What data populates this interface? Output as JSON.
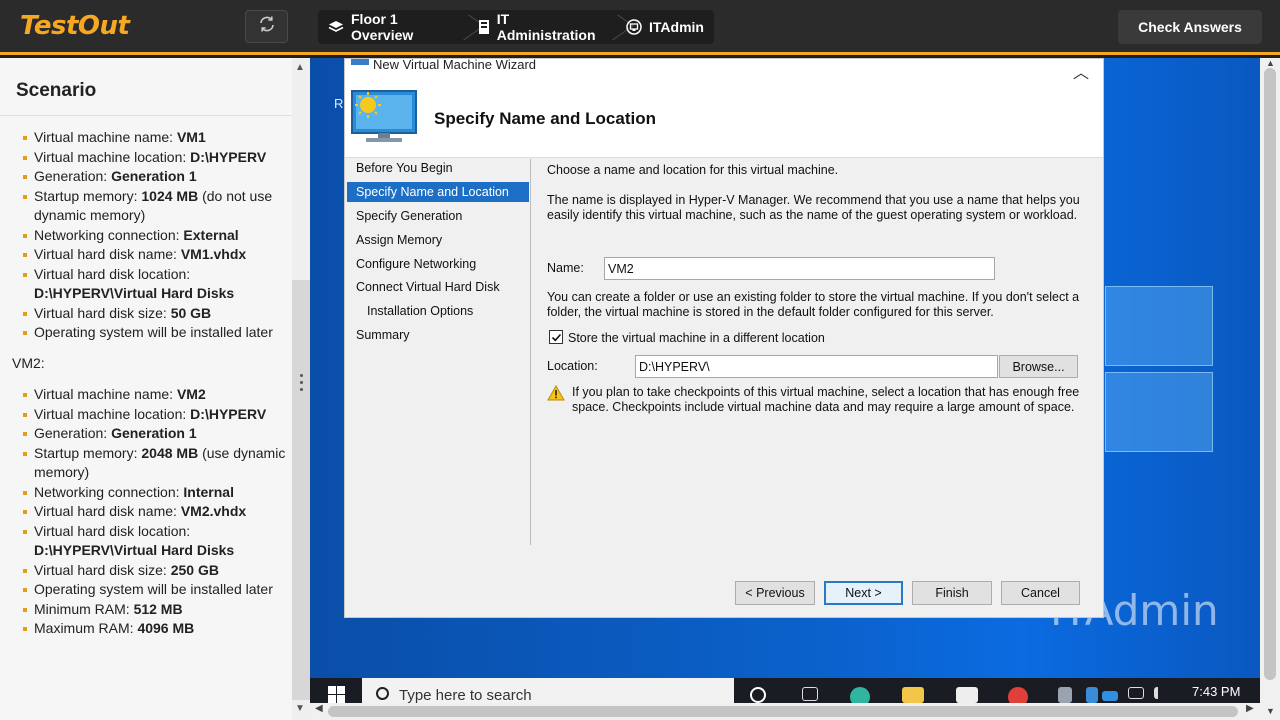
{
  "topbar": {
    "logo": "TestOut",
    "breadcrumbs": [
      {
        "label": "Floor 1 Overview",
        "icon": "layers-icon"
      },
      {
        "label": "IT Administration",
        "icon": "server-rack-icon"
      },
      {
        "label": "ITAdmin",
        "icon": "computer-icon"
      }
    ],
    "check_answers": "Check Answers",
    "accent": "#f7a823"
  },
  "scenario": {
    "title": "Scenario",
    "vm1_items": [
      {
        "label": "Virtual machine name: ",
        "value": "VM1",
        "rest": ""
      },
      {
        "label": "Virtual machine location: ",
        "value": "D:\\HYPERV",
        "rest": ""
      },
      {
        "label": "Generation: ",
        "value": "Generation 1",
        "rest": ""
      },
      {
        "label": "Startup memory: ",
        "value": "1024 MB",
        "rest": " (do not use dynamic memory)"
      },
      {
        "label": "Networking connection: ",
        "value": "External",
        "rest": ""
      },
      {
        "label": "Virtual hard disk name: ",
        "value": "VM1.vhdx",
        "rest": ""
      },
      {
        "label": "Virtual hard disk location: ",
        "value": "D:\\HYPERV\\Virtual Hard Disks",
        "rest": ""
      },
      {
        "label": "Virtual hard disk size: ",
        "value": "50 GB",
        "rest": ""
      },
      {
        "label": "Operating system will be installed later",
        "value": "",
        "rest": ""
      }
    ],
    "vm2_label": "VM2:",
    "vm2_items": [
      {
        "label": "Virtual machine name: ",
        "value": "VM2",
        "rest": ""
      },
      {
        "label": "Virtual machine location: ",
        "value": "D:\\HYPERV",
        "rest": ""
      },
      {
        "label": "Generation: ",
        "value": "Generation 1",
        "rest": ""
      },
      {
        "label": "Startup memory: ",
        "value": "2048 MB",
        "rest": " (use dynamic memory)"
      },
      {
        "label": "Networking connection: ",
        "value": "Internal",
        "rest": ""
      },
      {
        "label": "Virtual hard disk name: ",
        "value": "VM2.vhdx",
        "rest": ""
      },
      {
        "label": "Virtual hard disk location: ",
        "value": "D:\\HYPERV\\Virtual Hard Disks",
        "rest": ""
      },
      {
        "label": "Virtual hard disk size: ",
        "value": "250 GB",
        "rest": ""
      },
      {
        "label": "Operating system will be installed later",
        "value": "",
        "rest": ""
      },
      {
        "label": "Minimum RAM: ",
        "value": "512 MB",
        "rest": ""
      },
      {
        "label": "Maximum RAM: ",
        "value": "4096 MB",
        "rest": ""
      }
    ]
  },
  "desktop": {
    "watermark": "ITAdmin",
    "partial_label": "R"
  },
  "wizard": {
    "window_title": "New Virtual Machine Wizard",
    "header_title": "Specify Name and Location",
    "nav": [
      "Before You Begin",
      "Specify Name and Location",
      "Specify Generation",
      "Assign Memory",
      "Configure Networking",
      "Connect Virtual Hard Disk",
      "Installation Options",
      "Summary"
    ],
    "active_index": 1,
    "intro": "Choose a name and location for this virtual machine.",
    "description": "The name is displayed in Hyper-V Manager. We recommend that you use a name that helps you easily identify this virtual machine, such as the name of the guest operating system or workload.",
    "name_label": "Name:",
    "name_value": "VM2",
    "folder_text": "You can create a folder or use an existing folder to store the virtual machine. If you don't select a folder, the virtual machine is stored in the default folder configured for this server.",
    "store_checkbox_label": "Store the virtual machine in a different location",
    "store_checked": true,
    "location_label": "Location:",
    "location_value": "D:\\HYPERV\\",
    "browse": "Browse...",
    "warning": "If you plan to take checkpoints of this virtual machine, select a location that has enough free space. Checkpoints include virtual machine data and may require a large amount of space.",
    "buttons": {
      "previous": "< Previous",
      "next": "Next >",
      "finish": "Finish",
      "cancel": "Cancel"
    }
  },
  "taskbar": {
    "search_placeholder": "Type here to search",
    "clock": "7:43 PM"
  }
}
